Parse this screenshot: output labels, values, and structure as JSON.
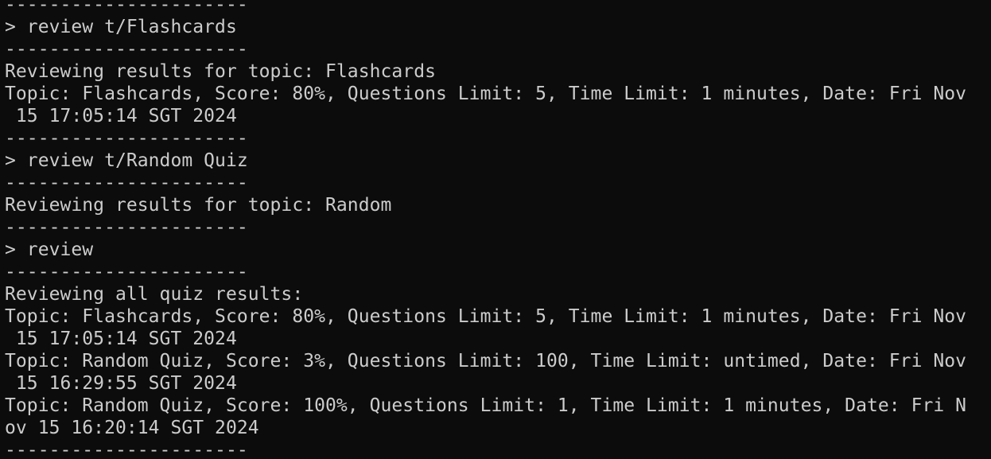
{
  "terminal": {
    "lines": [
      "----------------------",
      "> review t/Flashcards",
      "----------------------",
      "Reviewing results for topic: Flashcards",
      "Topic: Flashcards, Score: 80%, Questions Limit: 5, Time Limit: 1 minutes, Date: Fri Nov",
      " 15 17:05:14 SGT 2024",
      "----------------------",
      "> review t/Random Quiz",
      "----------------------",
      "Reviewing results for topic: Random",
      "----------------------",
      "> review",
      "----------------------",
      "Reviewing all quiz results:",
      "Topic: Flashcards, Score: 80%, Questions Limit: 5, Time Limit: 1 minutes, Date: Fri Nov",
      " 15 17:05:14 SGT 2024",
      "Topic: Random Quiz, Score: 3%, Questions Limit: 100, Time Limit: untimed, Date: Fri Nov",
      " 15 16:29:55 SGT 2024",
      "Topic: Random Quiz, Score: 100%, Questions Limit: 1, Time Limit: 1 minutes, Date: Fri N",
      "ov 15 16:20:14 SGT 2024",
      "----------------------"
    ]
  }
}
